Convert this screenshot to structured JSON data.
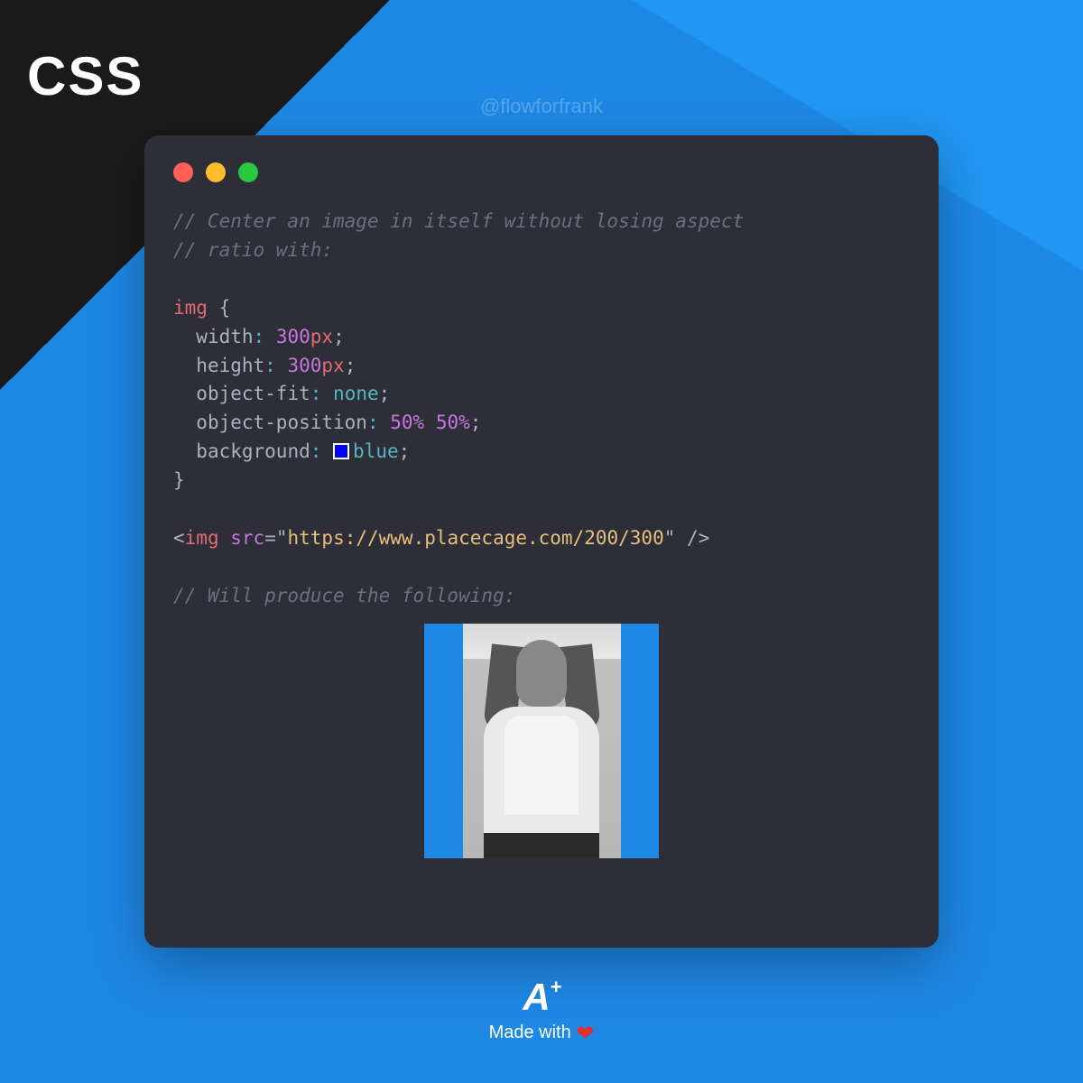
{
  "badge": "CSS",
  "handle": "@flowforfrank",
  "code": {
    "comment1": "// Center an image in itself without losing aspect",
    "comment2": "// ratio with:",
    "selector": "img",
    "brace_open": "{",
    "brace_close": "}",
    "prop_width": "width",
    "val_width_num": "300",
    "val_width_unit": "px",
    "prop_height": "height",
    "val_height_num": "300",
    "val_height_unit": "px",
    "prop_objfit": "object-fit",
    "val_objfit": "none",
    "prop_objpos": "object-position",
    "val_objpos1": "50%",
    "val_objpos2": "50%",
    "prop_bg": "background",
    "val_bg": "blue",
    "colon": ":",
    "semi": ";",
    "tag_open": "<",
    "tag_img": "img",
    "attr_src": "src",
    "eq": "=",
    "quote": "\"",
    "url": "https://www.placecage.com/200/300",
    "tag_close": "/>",
    "comment3": "// Will produce the following:"
  },
  "footer": {
    "logo_a": "A",
    "logo_plus": "+",
    "made_with": "Made with",
    "heart": "❤"
  }
}
